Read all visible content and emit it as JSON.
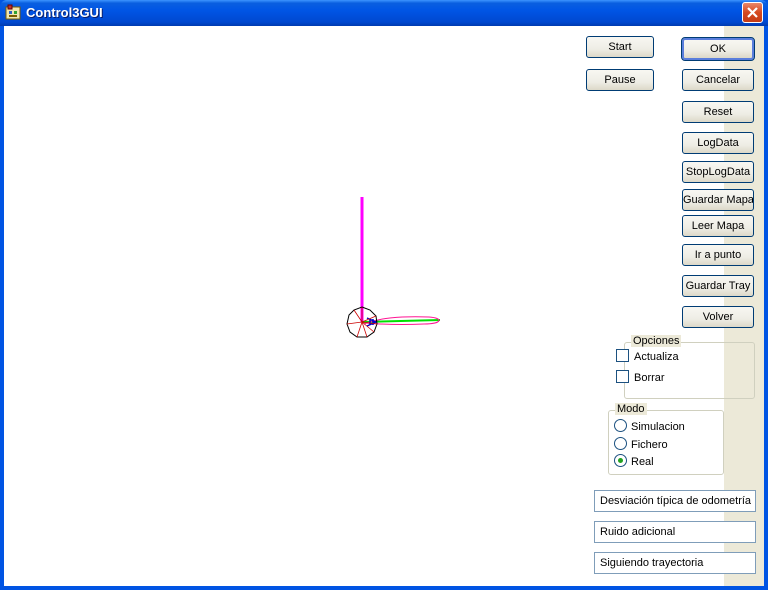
{
  "window": {
    "title": "Control3GUI",
    "colors": {
      "titlebar": "#0054e3",
      "face": "#ece9d8",
      "close": "#d6491f"
    }
  },
  "buttons": {
    "start": "Start",
    "pause": "Pause",
    "ok": "OK",
    "cancel": "Cancelar",
    "reset": "Reset",
    "logdata": "LogData",
    "stoplogdata": "StopLogData",
    "guardar_mapa": "Guardar Mapa",
    "leer_mapa": "Leer Mapa",
    "ir_a_punto": "Ir a punto",
    "guardar_tray": "Guardar Tray",
    "volver": "Volver"
  },
  "opciones": {
    "title": "Opciones",
    "actualiza": {
      "label": "Actualiza",
      "checked": false
    },
    "borrar": {
      "label": "Borrar",
      "checked": false
    }
  },
  "modo": {
    "title": "Modo",
    "options": [
      "Simulacion",
      "Fichero",
      "Real"
    ],
    "selected": "Real"
  },
  "status": {
    "desviacion": "Desviación típica de odometría",
    "ruido": "Ruido adicional",
    "siguiendo": "Siguiendo trayectoria"
  },
  "canvas": {
    "colors": {
      "axis_y": "#ff00ff",
      "axis_x": "#00e000",
      "robot": "#8b0000",
      "heading": "#0000cc"
    }
  }
}
